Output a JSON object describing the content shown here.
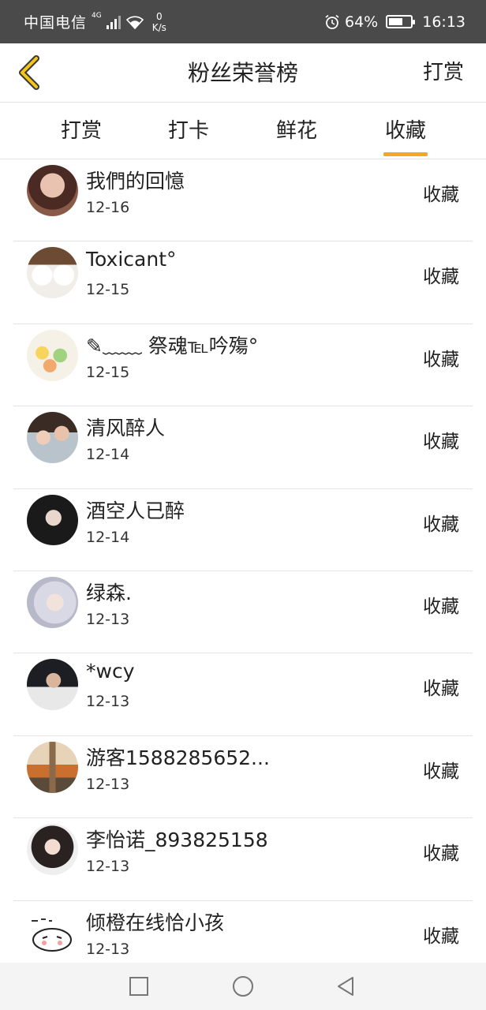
{
  "status_bar": {
    "carrier": "中国电信",
    "network": "4G",
    "speed_value": "0",
    "speed_unit": "K/s",
    "battery": "64%",
    "time": "16:13",
    "battery_level": 0.64
  },
  "header": {
    "back_icon": "chevron-left-icon",
    "title": "粉丝荣誉榜",
    "action": "打赏"
  },
  "tabs": [
    {
      "label": "打赏",
      "active": false
    },
    {
      "label": "打卡",
      "active": false
    },
    {
      "label": "鲜花",
      "active": false
    },
    {
      "label": "收藏",
      "active": true
    }
  ],
  "accent_color": "#f5a623",
  "list": [
    {
      "name": "我們的回憶",
      "date": "12-16",
      "action": "收藏"
    },
    {
      "name": "Toxicant°",
      "date": "12-15",
      "action": "收藏"
    },
    {
      "name": "✎﹏﹏ 祭魂℡吟殤°",
      "date": "12-15",
      "action": "收藏"
    },
    {
      "name": "清风醉人",
      "date": "12-14",
      "action": "收藏"
    },
    {
      "name": "酒空人已醉",
      "date": "12-14",
      "action": "收藏"
    },
    {
      "name": "绿森.",
      "date": "12-13",
      "action": "收藏"
    },
    {
      "name": "*wcy",
      "date": "12-13",
      "action": "收藏"
    },
    {
      "name": "游客1588285652...",
      "date": "12-13",
      "action": "收藏"
    },
    {
      "name": "李怡诺_893825158",
      "date": "12-13",
      "action": "收藏"
    },
    {
      "name": "倾橙在线恰小孩",
      "date": "12-13",
      "action": "收藏"
    }
  ],
  "navbar": {
    "recent_icon": "square-icon",
    "home_icon": "circle-icon",
    "back_icon": "triangle-back-icon"
  }
}
